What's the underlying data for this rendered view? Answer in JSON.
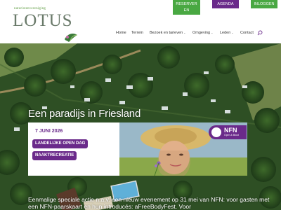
{
  "logo": {
    "tagline": "naturistenvereniging",
    "name": "LOTUS"
  },
  "top_buttons": {
    "reserve": "RESERVER EN",
    "agenda": "AGENDA",
    "login": "INLOGGEN"
  },
  "nav": {
    "items": [
      {
        "label": "Home",
        "dropdown": false
      },
      {
        "label": "Terrein",
        "dropdown": false
      },
      {
        "label": "Bezoek en tarieven",
        "dropdown": true
      },
      {
        "label": "Omgeving",
        "dropdown": true
      },
      {
        "label": "Leden",
        "dropdown": true
      },
      {
        "label": "Contact",
        "dropdown": false
      }
    ],
    "search_icon": "search-icon"
  },
  "hero": {
    "title": "Een paradijs in Friesland",
    "banner": {
      "date": "7 JUNI 2026",
      "line1": "LANDELIJKE OPEN DAG",
      "line2": "NAAKTRECREATIE",
      "badge_name": "NFN",
      "badge_sub": "Open & Bloot"
    },
    "description": "Eenmalige speciale actie n.a.v. een nieuw evenement op 31 mei van NFN: voor gasten met een NFN-paarskaart en hun introducés: aFreeBodyFest. Voor"
  },
  "colors": {
    "green": "#49a842",
    "purple": "#6a2a8a"
  }
}
